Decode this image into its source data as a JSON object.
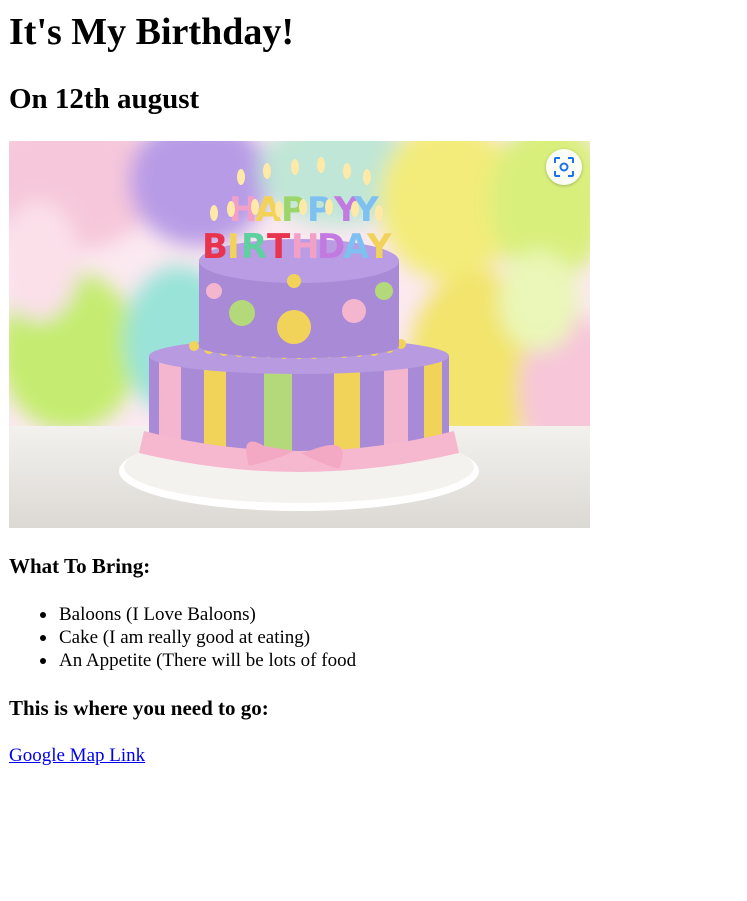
{
  "header": {
    "title": "It's My Birthday!",
    "subtitle": "On 12th august"
  },
  "image": {
    "alt": "Birthday cake",
    "lens_icon": "visual-search-icon",
    "colors": {
      "pink": "#f4b6cf",
      "lilac": "#a98ad6",
      "yellow": "#f2d35a",
      "green": "#b3d97a"
    }
  },
  "bring": {
    "heading": "What To Bring:",
    "items": [
      "Baloons (I Love Baloons)",
      "Cake (I am really good at eating)",
      "An Appetite (There will be lots of food"
    ]
  },
  "directions": {
    "heading": "This is where you need to go:",
    "link_text": "Google Map Link"
  }
}
